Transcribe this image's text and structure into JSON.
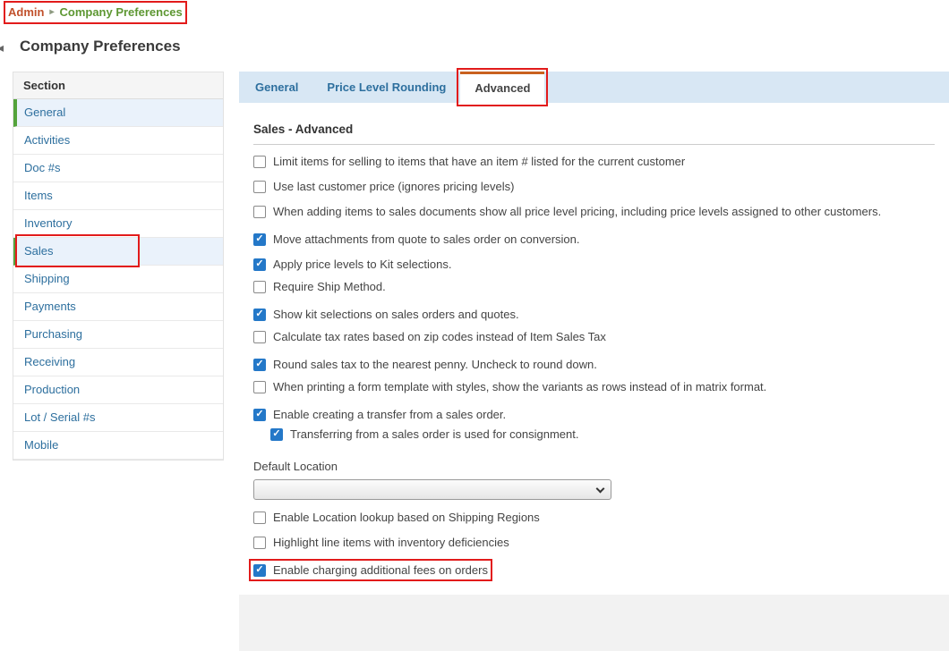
{
  "breadcrumb": {
    "admin": "Admin",
    "separator": "▸",
    "current": "Company Preferences"
  },
  "page": {
    "title": "Company Preferences"
  },
  "icons": {
    "collapse": "◂",
    "checkmark": "✓"
  },
  "sidebar": {
    "header": "Section",
    "items": [
      {
        "label": "General",
        "selected": true
      },
      {
        "label": "Activities"
      },
      {
        "label": "Doc #s"
      },
      {
        "label": "Items"
      },
      {
        "label": "Inventory"
      },
      {
        "label": "Sales",
        "selected": true,
        "annotated": true
      },
      {
        "label": "Shipping"
      },
      {
        "label": "Payments"
      },
      {
        "label": "Purchasing"
      },
      {
        "label": "Receiving"
      },
      {
        "label": "Production"
      },
      {
        "label": "Lot / Serial #s"
      },
      {
        "label": "Mobile"
      }
    ]
  },
  "tabs": [
    {
      "label": "General"
    },
    {
      "label": "Price Level Rounding"
    },
    {
      "label": "Advanced",
      "active": true,
      "annotated": true
    }
  ],
  "content": {
    "heading": "Sales - Advanced",
    "checkboxes_top": [
      {
        "label": "Limit items for selling to items that have an item # listed for the current customer",
        "checked": false
      },
      {
        "label": "Use last customer price (ignores pricing levels)",
        "checked": false
      },
      {
        "label": "When adding items to sales documents show all price level pricing, including price levels assigned to other customers.",
        "checked": false
      },
      {
        "label": "Move attachments from quote to sales order on conversion.",
        "checked": true
      },
      {
        "label": "Apply price levels to Kit selections.",
        "checked": true
      },
      {
        "label": "Require Ship Method.",
        "checked": false
      },
      {
        "label": "Show kit selections on sales orders and quotes.",
        "checked": true
      },
      {
        "label": "Calculate tax rates based on zip codes instead of Item Sales Tax",
        "checked": false
      },
      {
        "label": "Round sales tax to the nearest penny. Uncheck to round down.",
        "checked": true
      },
      {
        "label": "When printing a form template with styles, show the variants as rows instead of in matrix format.",
        "checked": false
      },
      {
        "label": "Enable creating a transfer from a sales order.",
        "checked": true
      },
      {
        "label": "Transferring from a sales order is used for consignment.",
        "checked": true,
        "indent": true
      }
    ],
    "default_location": {
      "label": "Default Location",
      "value": ""
    },
    "checkboxes_bottom": [
      {
        "label": "Enable Location lookup based on Shipping Regions",
        "checked": false
      },
      {
        "label": "Highlight line items with inventory deficiencies",
        "checked": false
      },
      {
        "label": "Enable charging additional fees on orders",
        "checked": true,
        "annotated": true
      }
    ]
  },
  "colors": {
    "annotation": "#e21b1b",
    "breadcrumb_admin": "#c1512c",
    "breadcrumb_current": "#5d9732",
    "link_blue": "#2d6f9e",
    "tab_bar_bg": "#d8e7f4",
    "tab_active_border": "#c9611f",
    "checkbox_checked": "#2478c8",
    "selected_green": "#54a33b",
    "selected_bg": "#eaf2fb"
  }
}
